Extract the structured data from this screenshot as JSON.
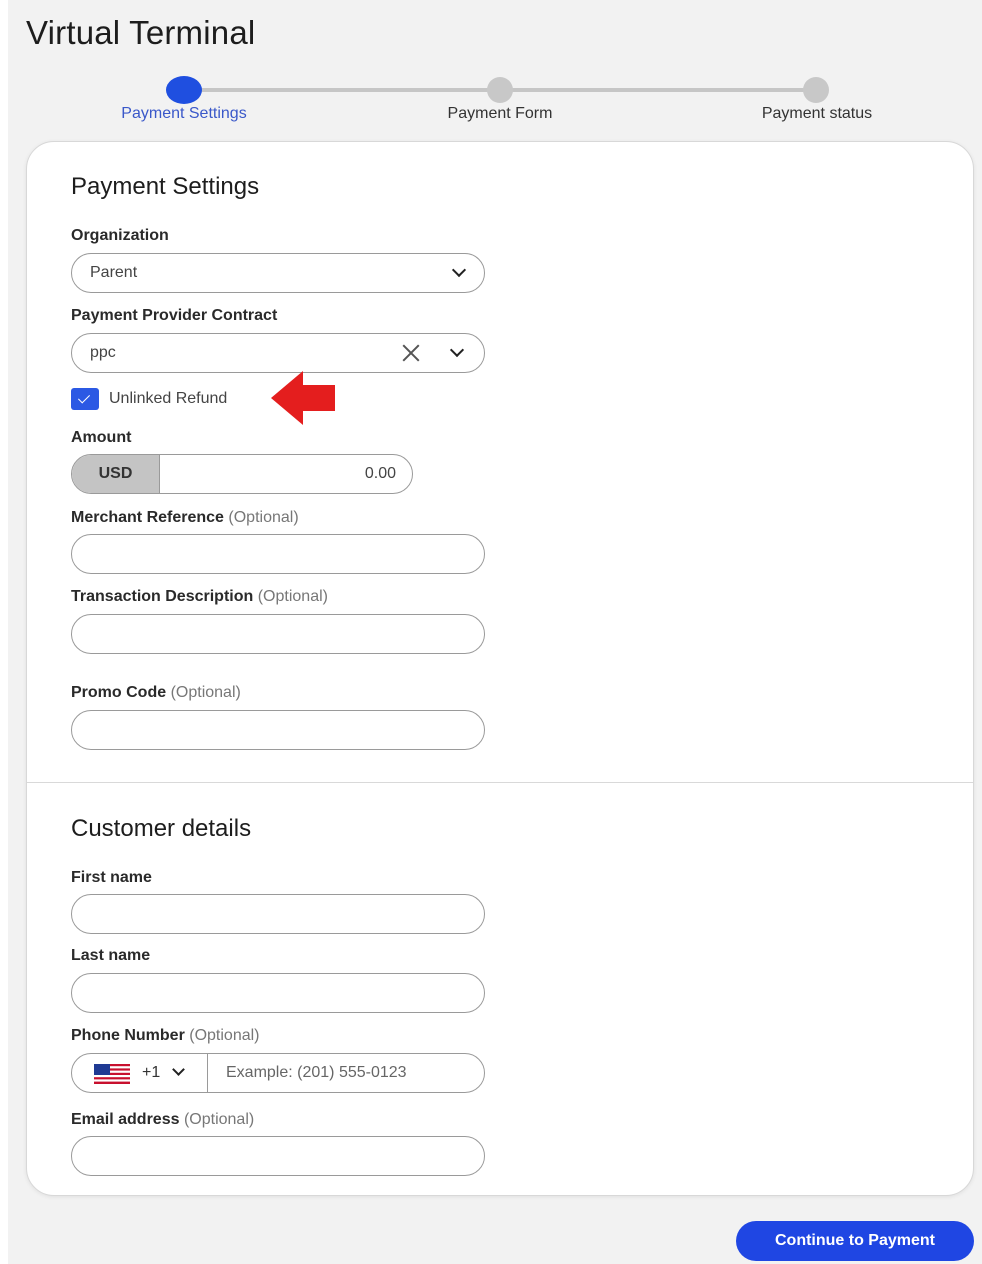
{
  "app": {
    "title": "Virtual Terminal"
  },
  "stepper": {
    "steps": [
      {
        "label": "Payment Settings",
        "active": true
      },
      {
        "label": "Payment Form",
        "active": false
      },
      {
        "label": "Payment status",
        "active": false
      }
    ]
  },
  "payment_settings": {
    "title": "Payment Settings",
    "organization": {
      "label": "Organization",
      "value": "Parent"
    },
    "provider_contract": {
      "label": "Payment Provider Contract",
      "value": "ppc"
    },
    "unlinked_refund": {
      "label": "Unlinked Refund",
      "checked": true
    },
    "amount": {
      "label": "Amount",
      "currency": "USD",
      "value": "0.00"
    },
    "merchant_reference": {
      "label": "Merchant Reference",
      "optional": "(Optional)",
      "value": ""
    },
    "transaction_description": {
      "label": "Transaction Description",
      "optional": "(Optional)",
      "value": ""
    },
    "promo_code": {
      "label": "Promo Code",
      "optional": "(Optional)",
      "value": ""
    }
  },
  "customer_details": {
    "title": "Customer details",
    "first_name": {
      "label": "First name",
      "value": ""
    },
    "last_name": {
      "label": "Last name",
      "value": ""
    },
    "phone": {
      "label": "Phone Number",
      "optional": "(Optional)",
      "country_code": "+1",
      "placeholder": "Example: (201) 555-0123"
    },
    "email": {
      "label": "Email address",
      "optional": "(Optional)",
      "value": ""
    }
  },
  "actions": {
    "continue_label": "Continue to Payment"
  },
  "colors": {
    "accent": "#1f46e3",
    "annotation_arrow": "#e41e1e"
  },
  "icons": [
    "chevron-down-icon",
    "clear-x-icon",
    "checkmark-icon",
    "us-flag-icon",
    "red-arrow-annotation"
  ]
}
